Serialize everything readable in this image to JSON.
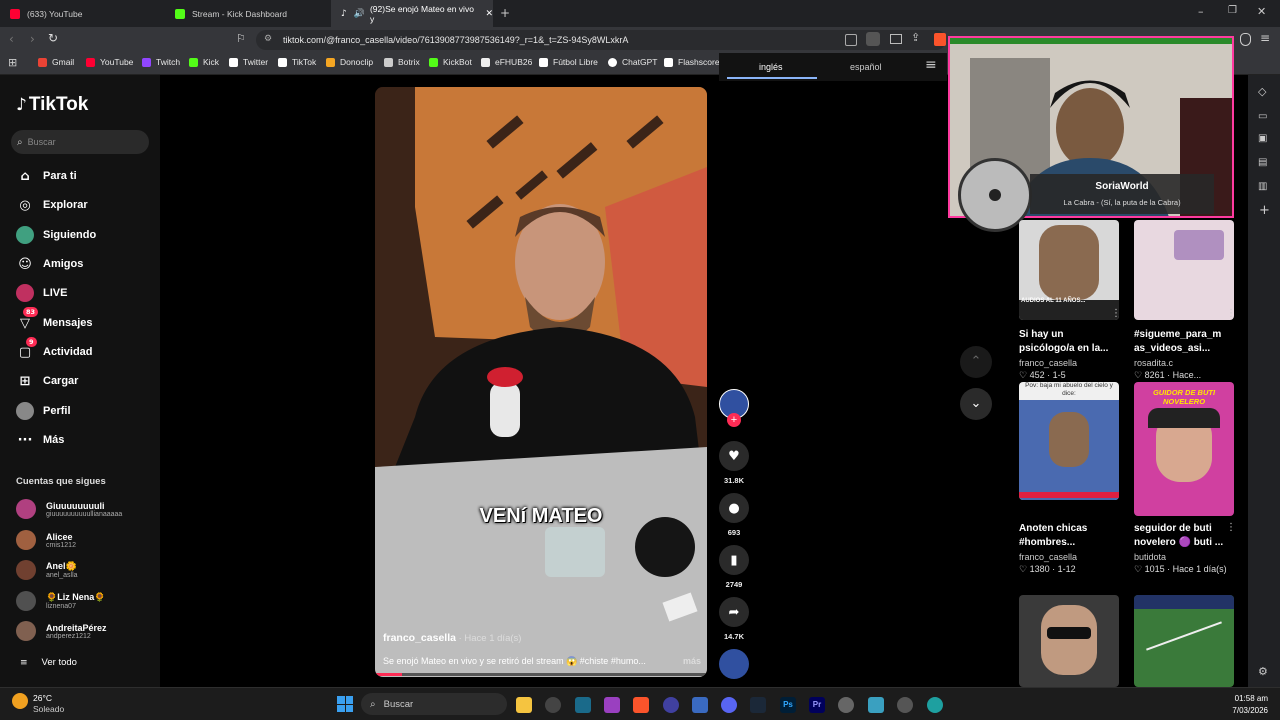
{
  "browser": {
    "tabs": [
      {
        "label": "(633) YouTube",
        "color": "#ff0033"
      },
      {
        "label": "Stream - Kick Dashboard",
        "color": "#53fc18"
      },
      {
        "label": "(92)Se enojó Mateo en vivo y",
        "color": "#ffffff"
      }
    ],
    "url": "tiktok.com/@franco_casella/video/7613908773987536149?_r=1&_t=ZS-94Sy8WLxkrA",
    "bookmarks": [
      {
        "label": "Gmail",
        "color": "#ea4335"
      },
      {
        "label": "YouTube",
        "color": "#ff0033"
      },
      {
        "label": "Twitch",
        "color": "#9146ff"
      },
      {
        "label": "Kick",
        "color": "#53fc18"
      },
      {
        "label": "Twitter",
        "color": "#ffffff"
      },
      {
        "label": "TikTok",
        "color": "#ffffff"
      },
      {
        "label": "Donoclip",
        "color": "#f5a623"
      },
      {
        "label": "Botrix",
        "color": "#cccccc"
      },
      {
        "label": "KickBot",
        "color": "#53fc18"
      },
      {
        "label": "eFHUB26",
        "color": "#eeeeee"
      },
      {
        "label": "Fútbol Libre",
        "color": "#ffffff"
      },
      {
        "label": "ChatGPT",
        "color": "#ffffff"
      },
      {
        "label": "Flashscore",
        "color": "#ffffff"
      }
    ]
  },
  "translate": {
    "lang1": "inglés",
    "lang2": "español"
  },
  "sidebar": {
    "logo": "TikTok",
    "search_placeholder": "Buscar",
    "nav": [
      {
        "label": "Para ti",
        "icon": "home-icon"
      },
      {
        "label": "Explorar",
        "icon": "compass-icon"
      },
      {
        "label": "Siguiendo",
        "icon": "following-icon"
      },
      {
        "label": "Amigos",
        "icon": "friends-icon"
      },
      {
        "label": "LIVE",
        "icon": "live-icon"
      },
      {
        "label": "Mensajes",
        "icon": "messages-icon",
        "badge": "83"
      },
      {
        "label": "Actividad",
        "icon": "activity-icon",
        "badge": "9"
      },
      {
        "label": "Cargar",
        "icon": "upload-icon"
      },
      {
        "label": "Perfil",
        "icon": "profile-icon"
      },
      {
        "label": "Más",
        "icon": "more-icon"
      }
    ],
    "following_title": "Cuentas que sigues",
    "following": [
      {
        "name": "Giuuuuuuuuli",
        "handle": "giuuuuuuuuuullianaaaaa",
        "color": "#b04080"
      },
      {
        "name": "Alicee",
        "handle": "cmis1212",
        "color": "#a06040"
      },
      {
        "name": "Anel🌼",
        "handle": "anel_aslla",
        "color": "#704030"
      },
      {
        "name": "🌻Liz Nena🌻",
        "handle": "liznena07",
        "color": "#505050"
      },
      {
        "name": "AndreitaPérez",
        "handle": "andperez1212",
        "color": "#806050"
      }
    ],
    "see_all": "Ver todo"
  },
  "video": {
    "caption_overlay": "VENí MATEO",
    "author": "franco_casella",
    "time": " · Hace 1 día(s)",
    "description": "Se enojó Mateo en vivo y se retiró del stream 😱 #chiste #humo...",
    "more": "más"
  },
  "actions": {
    "likes": "31.8K",
    "comments": "693",
    "saves": "2749",
    "shares": "14.7K"
  },
  "overlay": {
    "name": "SoriaWorld",
    "song": "La Cabra - (Sí, la puta de la Cabra)"
  },
  "grid": [
    {
      "title1": "Si hay un",
      "title2": "psicólogo/a en la...",
      "author": "franco_casella",
      "meta": "♡ 452 · 1-5",
      "thumb_text": "AUDIOS AL 11 AÑOS...",
      "bg": "#d8d8d8"
    },
    {
      "title1": "#sigueme_para_m",
      "title2": "as_videos_asi...",
      "author": "rosadita.c",
      "meta": "♡ 8261 · Hace...",
      "thumb_text": "",
      "bg": "#e8d8e0"
    },
    {
      "title1": "Anoten chicas",
      "title2": "#hombres...",
      "author": "franco_casella",
      "meta": "♡ 1380 · 1-12",
      "thumb_text": "Pov: baja mi abuelo del cielo y dice:",
      "bg": "#f0f0f0"
    },
    {
      "title1": "seguidor de buti",
      "title2": "novelero 🟣 buti ...",
      "author": "butidota",
      "meta": "♡ 1015 · Hace 1 día(s)",
      "thumb_text": "GUIDOR DE BUTI NOVELERO",
      "bg": "#d040a0"
    },
    {
      "title1": "",
      "title2": "",
      "author": "",
      "meta": "",
      "thumb_text": "",
      "bg": "#3a3a3a"
    },
    {
      "title1": "",
      "title2": "",
      "author": "",
      "meta": "",
      "thumb_text": "",
      "bg": "#3a7a3a"
    }
  ],
  "taskbar": {
    "weather_temp": "26°C",
    "weather_desc": "Soleado",
    "search": "Buscar",
    "time": "01:58 am",
    "date": "7/03/2026"
  }
}
